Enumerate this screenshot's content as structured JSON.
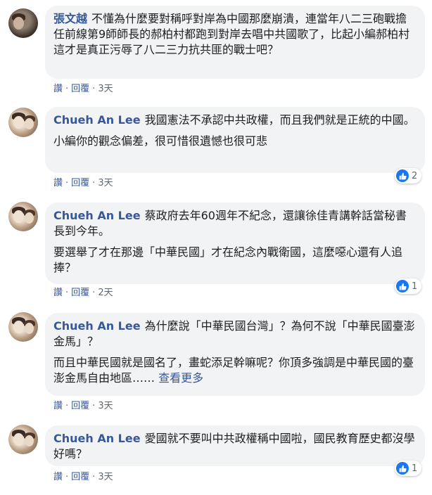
{
  "comments": [
    {
      "author": "張文越",
      "paragraphs": [
        "不懂為什麼要對稱呼對岸為中國那麼崩潰，連當年八二三砲戰擔任前線第9師師長的郝柏村都跑到對岸去唱中共國歌了，比起小編郝柏村這才是真正污辱了八二三力抗共匪的戰士吧？"
      ],
      "like": "讚",
      "reply": "回覆",
      "time": "3天",
      "reactions": null
    },
    {
      "author": "Chueh An Lee",
      "paragraphs": [
        "我國憲法不承認中共政權，而且我們就是正統的中國。",
        "小編你的觀念偏差，很可惜很遺憾也很可悲"
      ],
      "like": "讚",
      "reply": "回覆",
      "time": "3天",
      "reactions": "2"
    },
    {
      "author": "Chueh An Lee",
      "paragraphs": [
        "蔡政府去年60週年不紀念，還讓徐佳青講幹話當秘書長到今年。",
        "要選舉了才在那邊「中華民國」才在紀念內戰衛國，這麼噁心還有人追捧？"
      ],
      "like": "讚",
      "reply": "回覆",
      "time": "2天",
      "reactions": "1"
    },
    {
      "author": "Chueh An Lee",
      "paragraphs": [
        "為什麼說「中華民國台灣」？為何不說「中華民國臺澎金馬」？",
        "而且中華民國就是國名了，畫蛇添足幹嘛呢？你頂多強調是中華民國的臺澎金馬自由地區……"
      ],
      "see_more": "查看更多",
      "like": "讚",
      "reply": "回覆",
      "time": "3天",
      "reactions": null
    },
    {
      "author": "Chueh An Lee",
      "paragraphs": [
        "愛國就不要叫中共政權稱中國啦，國民教育歷史都沒學好嗎？"
      ],
      "like": "讚",
      "reply": "回覆",
      "time": "3天",
      "reactions": "1"
    }
  ],
  "colors": {
    "link": "#385898",
    "bubble": "#f2f3f5",
    "like_blue": "#1877f2"
  }
}
